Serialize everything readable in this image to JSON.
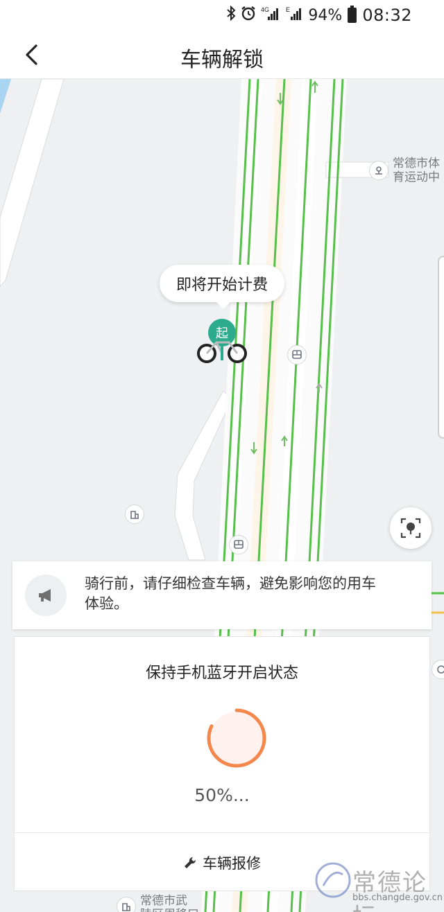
{
  "status_bar": {
    "network": "4G",
    "network_secondary": "E",
    "battery": "94%",
    "time": "08:32"
  },
  "nav": {
    "title": "车辆解锁"
  },
  "map": {
    "bubble_text": "即将开始计费",
    "start_marker_label": "起",
    "poi_labels": [
      {
        "text": "常德市体\n育运动中"
      },
      {
        "text": "常德市武\n陵区周移口"
      }
    ]
  },
  "notice": {
    "text": "骑行前，请仔细检查车辆，避免影响您的用车体验。"
  },
  "unlock": {
    "title": "保持手机蓝牙开启状态",
    "progress": 0.5,
    "progress_text": "50%...",
    "repair_label": "车辆报修"
  },
  "watermark": {
    "title": "常德论坛",
    "url": "bbs.changde.gov.cn"
  },
  "colors": {
    "accent_green": "#2dab8d",
    "road_green": "#57c04a",
    "progress_orange": "#f4874b"
  }
}
